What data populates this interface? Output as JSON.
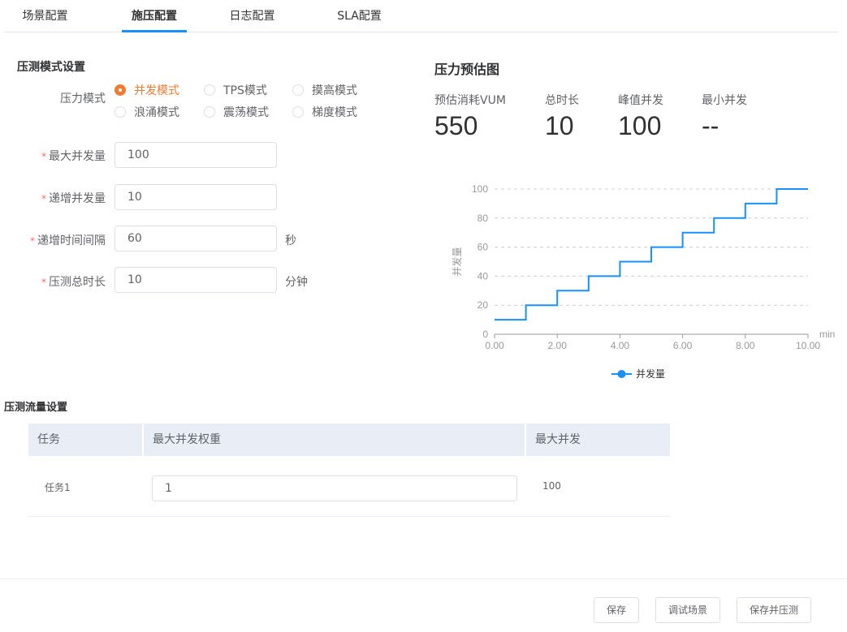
{
  "tabs": [
    {
      "label": "场景配置"
    },
    {
      "label": "施压配置"
    },
    {
      "label": "日志配置"
    },
    {
      "label": "SLA配置"
    }
  ],
  "active_tab": "施压配置",
  "pressure_mode_section": {
    "title": "压测模式设置",
    "mode_label": "压力模式",
    "modes": [
      {
        "label": "并发模式",
        "checked": true
      },
      {
        "label": "TPS模式",
        "checked": false
      },
      {
        "label": "摸高模式",
        "checked": false
      },
      {
        "label": "浪涌模式",
        "checked": false
      },
      {
        "label": "震荡模式",
        "checked": false
      },
      {
        "label": "梯度模式",
        "checked": false
      }
    ],
    "fields": [
      {
        "label": "最大并发量",
        "value": "100",
        "unit": "",
        "required": true
      },
      {
        "label": "递增并发量",
        "value": "10",
        "unit": "",
        "required": true
      },
      {
        "label": "递增时间间隔",
        "value": "60",
        "unit": "秒",
        "required": true
      },
      {
        "label": "压测总时长",
        "value": "10",
        "unit": "分钟",
        "required": true
      }
    ],
    "required_mark": "*"
  },
  "estimate": {
    "title": "压力预估图",
    "stats": [
      {
        "label": "预估消耗VUM",
        "value": "550"
      },
      {
        "label": "总时长",
        "value": "10"
      },
      {
        "label": "峰值并发",
        "value": "100"
      },
      {
        "label": "最小并发",
        "value": "--"
      }
    ]
  },
  "chart_data": {
    "type": "line",
    "step": true,
    "ylabel": "并发量",
    "xlabel": "min",
    "xlim": [
      0,
      10
    ],
    "ylim": [
      0,
      100
    ],
    "x_ticks": [
      "0.00",
      "2.00",
      "4.00",
      "6.00",
      "8.00",
      "10.00"
    ],
    "y_ticks": [
      "0",
      "20",
      "40",
      "60",
      "80",
      "100"
    ],
    "grid": true,
    "legend": "bottom",
    "color": "#1890ff",
    "series": [
      {
        "name": "并发量",
        "x": [
          0,
          1,
          2,
          3,
          4,
          5,
          6,
          7,
          8,
          9,
          10
        ],
        "y": [
          10,
          20,
          30,
          40,
          50,
          60,
          70,
          80,
          90,
          100,
          100
        ]
      }
    ]
  },
  "traffic_section": {
    "title": "压测流量设置",
    "columns": [
      "任务",
      "最大并发权重",
      "最大并发"
    ],
    "rows": [
      {
        "task": "任务1",
        "weight": "1",
        "max": "100"
      }
    ]
  },
  "footer": {
    "save": "保存",
    "debug": "调试场景",
    "save_and_run": "保存并压测"
  },
  "colors": {
    "accent_orange": "#f07c33",
    "primary_blue": "#1890ff"
  }
}
